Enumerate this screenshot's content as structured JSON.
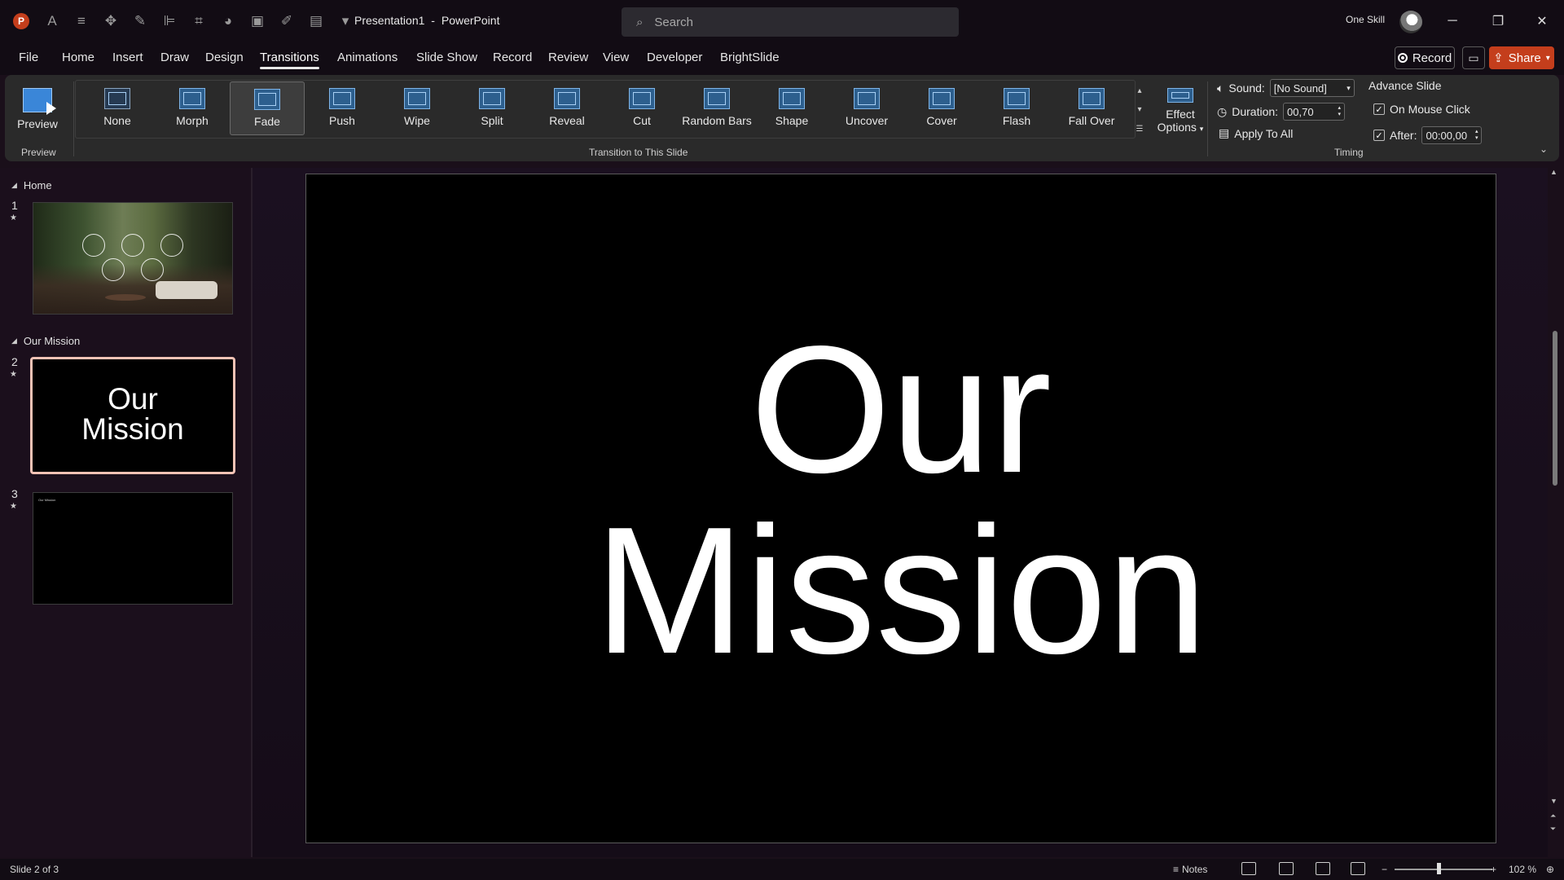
{
  "app": {
    "logo_letter": "P",
    "document_name": "Presentation1",
    "separator": "-",
    "app_name": "PowerPoint",
    "account_name": "One Skill"
  },
  "search": {
    "placeholder": "Search"
  },
  "menu": {
    "tabs": [
      "File",
      "Home",
      "Insert",
      "Draw",
      "Design",
      "Transitions",
      "Animations",
      "Slide Show",
      "Record",
      "Review",
      "View",
      "Developer",
      "BrightSlide"
    ],
    "active_tab": "Transitions",
    "record_label": "Record",
    "share_label": "Share"
  },
  "ribbon": {
    "preview_label": "Preview",
    "preview_group": "Preview",
    "transitions_group": "Transition to This Slide",
    "transitions": [
      {
        "label": "None",
        "icon": "none-transition-icon"
      },
      {
        "label": "Morph",
        "icon": "morph-transition-icon"
      },
      {
        "label": "Fade",
        "icon": "fade-transition-icon"
      },
      {
        "label": "Push",
        "icon": "push-transition-icon"
      },
      {
        "label": "Wipe",
        "icon": "wipe-transition-icon"
      },
      {
        "label": "Split",
        "icon": "split-transition-icon"
      },
      {
        "label": "Reveal",
        "icon": "reveal-transition-icon"
      },
      {
        "label": "Cut",
        "icon": "cut-transition-icon"
      },
      {
        "label": "Random Bars",
        "icon": "random-bars-transition-icon"
      },
      {
        "label": "Shape",
        "icon": "shape-transition-icon"
      },
      {
        "label": "Uncover",
        "icon": "uncover-transition-icon"
      },
      {
        "label": "Cover",
        "icon": "cover-transition-icon"
      },
      {
        "label": "Flash",
        "icon": "flash-transition-icon"
      },
      {
        "label": "Fall Over",
        "icon": "fall-over-transition-icon"
      }
    ],
    "selected_transition": "Fade",
    "effect_options_line1": "Effect",
    "effect_options_line2": "Options",
    "timing": {
      "sound_label": "Sound:",
      "sound_value": "[No Sound]",
      "duration_label": "Duration:",
      "duration_value": "00,70",
      "apply_all_label": "Apply To All",
      "advance_header": "Advance Slide",
      "on_mouse_click_label": "On Mouse Click",
      "on_mouse_click_checked": true,
      "after_label": "After:",
      "after_checked": true,
      "after_value": "00:00,00",
      "group_label": "Timing"
    }
  },
  "slides_pane": {
    "sections": [
      {
        "name": "Home"
      },
      {
        "name": "Our Mission"
      }
    ],
    "slides": [
      {
        "number": "1",
        "has_animation": true
      },
      {
        "number": "2",
        "has_animation": true,
        "text_line1": "Our",
        "text_line2": "Mission",
        "selected": true
      },
      {
        "number": "3",
        "has_animation": true,
        "tiny_text": "Our Mission"
      }
    ]
  },
  "main_slide": {
    "title_line1": "Our",
    "title_line2": "Mission",
    "background": "#000000",
    "text_color": "#ffffff"
  },
  "statusbar": {
    "slide_info": "Slide 2 of 3",
    "notes_label": "Notes",
    "zoom_value": "102 %"
  },
  "colors": {
    "accent": "#c43e1c",
    "chrome": "#120c14",
    "ribbon": "#2a2a2a",
    "selected_thumb_border": "#f2c2b5"
  }
}
